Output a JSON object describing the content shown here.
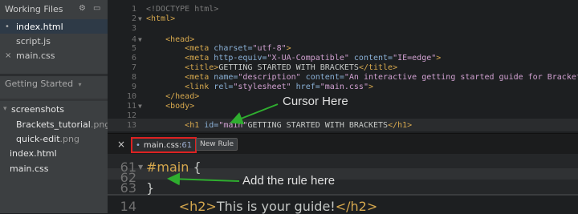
{
  "sidebar": {
    "working_files_title": "Working Files",
    "working_files": [
      {
        "name": "index.html",
        "prefix": "•"
      },
      {
        "name": "script.js",
        "prefix": ""
      },
      {
        "name": "main.css",
        "prefix": "×"
      }
    ],
    "project_title": "Getting Started",
    "project_caret": "▾",
    "tree": [
      {
        "label": "screenshots",
        "arrow": "▾"
      },
      {
        "label": "Brackets_tutorial",
        "ext": ".png"
      },
      {
        "label": "quick-edit",
        "ext": ".png"
      },
      {
        "label": "index.html",
        "ext": ""
      },
      {
        "label": "main.css",
        "ext": ""
      }
    ]
  },
  "editor": {
    "lines": [
      {
        "n": "1",
        "fold": "",
        "parts": [
          [
            "cmt",
            "<!DOCTYPE html>"
          ]
        ]
      },
      {
        "n": "2",
        "fold": "▼",
        "parts": [
          [
            "tag",
            "<html>"
          ]
        ]
      },
      {
        "n": "3",
        "fold": "",
        "parts": []
      },
      {
        "n": "4",
        "fold": "▼",
        "parts": [
          [
            "",
            "    "
          ],
          [
            "tag",
            "<head>"
          ]
        ]
      },
      {
        "n": "5",
        "fold": "",
        "parts": [
          [
            "",
            "        "
          ],
          [
            "tag",
            "<meta "
          ],
          [
            "attr",
            "charset="
          ],
          [
            "val",
            "\"utf-8\""
          ],
          [
            "tag",
            ">"
          ]
        ]
      },
      {
        "n": "6",
        "fold": "",
        "parts": [
          [
            "",
            "        "
          ],
          [
            "tag",
            "<meta "
          ],
          [
            "attr",
            "http-equiv="
          ],
          [
            "val",
            "\"X-UA-Compatible\""
          ],
          [
            "attr",
            " content="
          ],
          [
            "val",
            "\"IE=edge\""
          ],
          [
            "tag",
            ">"
          ]
        ]
      },
      {
        "n": "7",
        "fold": "",
        "parts": [
          [
            "",
            "        "
          ],
          [
            "tag",
            "<title>"
          ],
          [
            "",
            "GETTING STARTED WITH BRACKETS"
          ],
          [
            "tag",
            "</title>"
          ]
        ]
      },
      {
        "n": "8",
        "fold": "",
        "parts": [
          [
            "",
            "        "
          ],
          [
            "tag",
            "<meta "
          ],
          [
            "attr",
            "name="
          ],
          [
            "val",
            "\"description\""
          ],
          [
            "attr",
            " content="
          ],
          [
            "val",
            "\"An interactive getting started guide for Brackets.\""
          ],
          [
            "tag",
            ">"
          ]
        ]
      },
      {
        "n": "9",
        "fold": "",
        "parts": [
          [
            "",
            "        "
          ],
          [
            "tag",
            "<link "
          ],
          [
            "attr",
            "rel="
          ],
          [
            "val",
            "\"stylesheet\""
          ],
          [
            "attr",
            " href="
          ],
          [
            "val",
            "\"main.css\""
          ],
          [
            "tag",
            ">"
          ]
        ]
      },
      {
        "n": "10",
        "fold": "",
        "parts": [
          [
            "",
            "    "
          ],
          [
            "tag",
            "</head>"
          ]
        ]
      },
      {
        "n": "11",
        "fold": "▼",
        "parts": [
          [
            "",
            "    "
          ],
          [
            "tag",
            "<body>"
          ]
        ]
      },
      {
        "n": "12",
        "fold": "",
        "parts": []
      },
      {
        "n": "13",
        "fold": "",
        "parts": [
          [
            "",
            "        "
          ],
          [
            "tag",
            "<h1 "
          ],
          [
            "attr",
            "id="
          ],
          [
            "val",
            "\"main\""
          ],
          [
            "",
            "GETTING STARTED WITH BRACKETS"
          ],
          [
            "tag",
            "</h1>"
          ]
        ]
      }
    ],
    "inline_file": "main.css",
    "inline_sep": " : ",
    "inline_line": "61",
    "inline_close": "×",
    "inline_prefix": "•",
    "new_rule_label": "New Rule",
    "inline_lines": [
      {
        "n": "61",
        "fold": "▼",
        "parts": [
          [
            "tag",
            "#main"
          ],
          [
            "",
            " {"
          ]
        ]
      },
      {
        "n": "62",
        "fold": "",
        "parts": []
      },
      {
        "n": "63",
        "fold": "",
        "parts": [
          [
            "",
            "}"
          ]
        ]
      }
    ],
    "after_lines": [
      {
        "n": "14",
        "fold": "",
        "parts": [
          [
            "",
            "        "
          ],
          [
            "tag",
            "<h2>"
          ],
          [
            "",
            "This is your guide!"
          ],
          [
            "tag",
            "</h2>"
          ]
        ]
      }
    ]
  },
  "annotations": {
    "cursor": "Cursor Here",
    "rule": "Add the rule here"
  },
  "colors": {
    "annotation_arrow": "#2fae2f",
    "highlight_border": "#dd2222"
  }
}
